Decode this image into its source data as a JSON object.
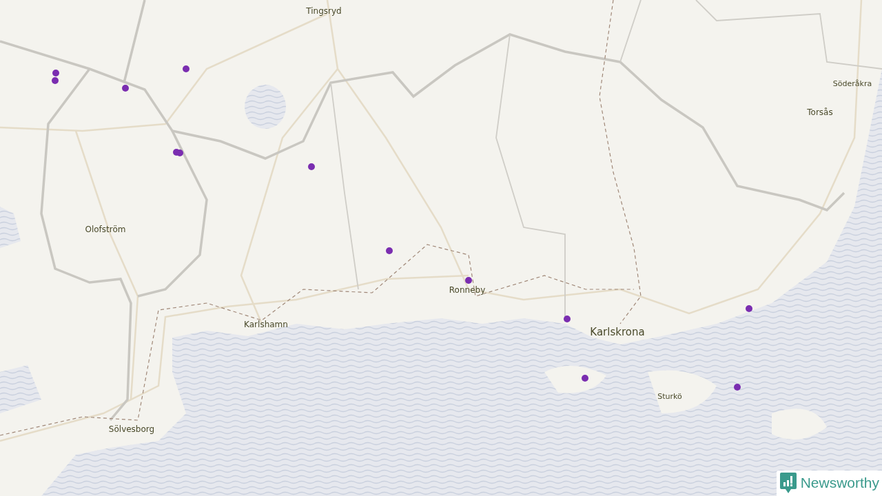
{
  "map": {
    "places": [
      {
        "name": "Tingsryd",
        "kind": "town"
      },
      {
        "name": "Söderåkra",
        "kind": "village"
      },
      {
        "name": "Torsås",
        "kind": "town"
      },
      {
        "name": "Olofström",
        "kind": "town"
      },
      {
        "name": "Ronneby",
        "kind": "town"
      },
      {
        "name": "Karlshamn",
        "kind": "town"
      },
      {
        "name": "Karlskrona",
        "kind": "city"
      },
      {
        "name": "Sturkö",
        "kind": "village"
      },
      {
        "name": "Sölvesborg",
        "kind": "town"
      }
    ],
    "markers": [
      {
        "kind": "dot"
      },
      {
        "kind": "dot"
      },
      {
        "kind": "dot"
      },
      {
        "kind": "dot"
      },
      {
        "kind": "dot"
      },
      {
        "kind": "dot"
      },
      {
        "kind": "dot"
      },
      {
        "kind": "dot"
      },
      {
        "kind": "dot"
      },
      {
        "kind": "dot"
      },
      {
        "kind": "dot"
      },
      {
        "kind": "dot"
      },
      {
        "kind": "dot"
      }
    ]
  },
  "logo": {
    "text": "Newsworthy"
  }
}
